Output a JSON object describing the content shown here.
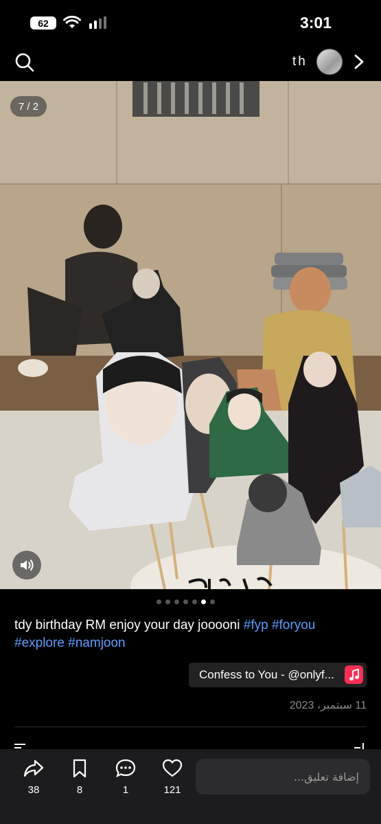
{
  "status_bar": {
    "battery": "62",
    "time": "3:01"
  },
  "top_nav": {
    "search_icon": "search-icon",
    "user_initials": "th",
    "next_icon": "chevron-right-icon"
  },
  "photo": {
    "counter": "7 / 2",
    "sound_icon": "speaker-icon"
  },
  "carousel": {
    "total": 7,
    "active_index": 5
  },
  "caption": {
    "text": "tdy birthday RM enjoy your day jooooni",
    "hashtags": [
      "#fyp",
      "#foryou",
      "#explore",
      "#namjoon"
    ]
  },
  "music": {
    "label": "Confess to You - @onlyf..."
  },
  "date": "11 سبتمبر، 2023",
  "actions": {
    "share_count": "38",
    "bookmark_count": "8",
    "comment_count": "1",
    "like_count": "121"
  },
  "comment": {
    "placeholder": "إضافة تعليق..."
  },
  "colors": {
    "hashtag": "#5b9eff",
    "music_icon": "#ff2d55",
    "bottom_bar": "#1c1c1e"
  }
}
